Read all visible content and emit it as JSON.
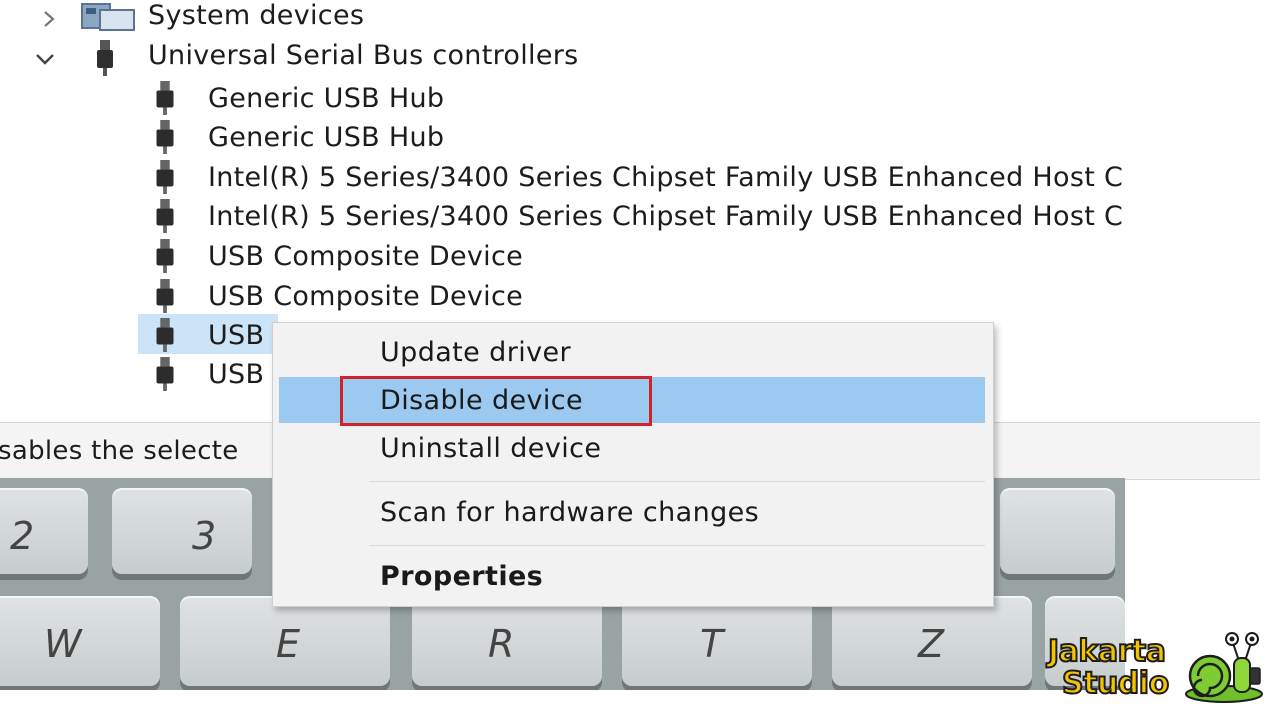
{
  "tree": {
    "categories": [
      {
        "label": "System devices",
        "expanded": false,
        "icon": "system-devices-icon"
      },
      {
        "label": "Universal Serial Bus controllers",
        "expanded": true,
        "icon": "usb-plug-icon"
      }
    ],
    "usb_items": [
      "Generic USB Hub",
      "Generic USB Hub",
      "Intel(R) 5 Series/3400 Series Chipset Family USB Enhanced Host C",
      "Intel(R) 5 Series/3400 Series Chipset Family USB Enhanced Host C",
      "USB Composite Device",
      "USB Composite Device",
      "USB",
      "USB"
    ],
    "selected_index": 6
  },
  "status_bar": {
    "text": "sables the selecte"
  },
  "context_menu": {
    "items": [
      {
        "label": "Update driver"
      },
      {
        "label": "Disable device",
        "highlighted": true
      },
      {
        "label": "Uninstall device"
      },
      {
        "label": "Scan for hardware changes"
      },
      {
        "label": "Properties",
        "bold": true
      }
    ]
  },
  "keyboard_keys": [
    "2",
    "3",
    "W",
    "E",
    "R",
    "T",
    "Z"
  ],
  "watermark": {
    "line1": "Jakarta",
    "line2": "Studio"
  },
  "colors": {
    "highlight": "#9bc9f0",
    "selection": "#cce4f7",
    "annotation_red": "#d0242a",
    "logo_yellow": "#f5c400"
  }
}
